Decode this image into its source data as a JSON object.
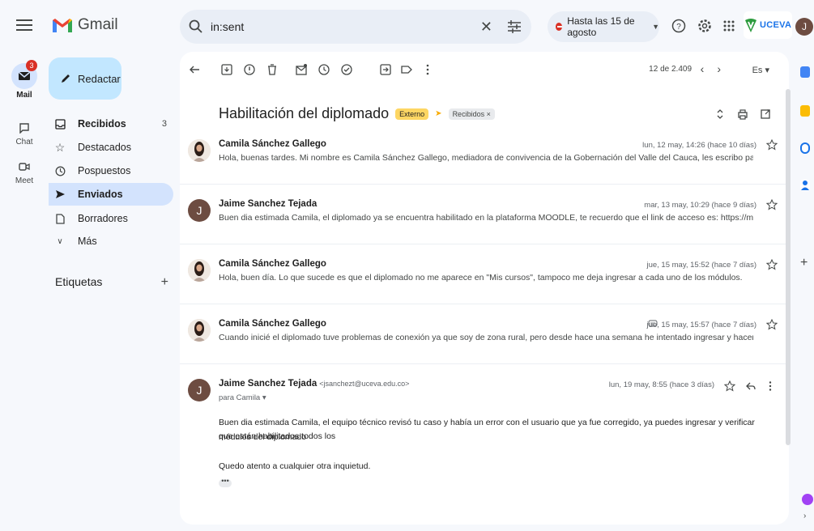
{
  "app": {
    "name": "Gmail"
  },
  "search": {
    "query": "in:sent"
  },
  "status": {
    "label": "Hasta las 15 de agosto"
  },
  "account": {
    "org": "UCEVA",
    "avatar_letter": "J"
  },
  "rail": {
    "mail": {
      "label": "Mail",
      "badge": "3"
    },
    "chat": {
      "label": "Chat"
    },
    "meet": {
      "label": "Meet"
    }
  },
  "compose": {
    "label": "Redactar"
  },
  "nav": {
    "items": [
      {
        "label": "Recibidos",
        "count": "3",
        "icon": "inbox-icon"
      },
      {
        "label": "Destacados",
        "count": "",
        "icon": "star-icon"
      },
      {
        "label": "Pospuestos",
        "count": "",
        "icon": "clock-icon"
      },
      {
        "label": "Enviados",
        "count": "",
        "icon": "send-icon"
      },
      {
        "label": "Borradores",
        "count": "",
        "icon": "draft-icon"
      },
      {
        "label": "Más",
        "count": "",
        "icon": "chevron-down-icon"
      }
    ],
    "labels_title": "Etiquetas",
    "labels_add": "+"
  },
  "toolbar": {
    "pager": "12 de 2.409",
    "lang": "Es"
  },
  "thread": {
    "subject": "Habilitación del diplomado",
    "badge_external": "Externo",
    "badge_inbox": "Recibidos ×",
    "messages": [
      {
        "from": "Camila Sánchez Gallego",
        "date": "lun, 12 may, 14:26 (hace 10 días)",
        "snippet": "Hola, buenas tardes. Mi nombre es Camila Sánchez Gallego, mediadora de convivencia de la Gobernación del Valle del Cauca, les escribo para solicitar por favor l"
      },
      {
        "from": "Jaime Sanchez Tejada",
        "date": "mar, 13 may, 10:29 (hace 9 días)",
        "snippet": "Buen dia estimada Camila, el diplomado ya se encuentra habilitado en la plataforma MOODLE, te recuerdo que el link de acceso es: https://moodleproyeccionsocial."
      },
      {
        "from": "Camila Sánchez Gallego",
        "date": "jue, 15 may, 15:52 (hace 7 días)",
        "snippet": "Hola, buen día. Lo que sucede es que el diplomado no me aparece en \"Mis cursos\", tampoco me deja ingresar a cada uno de los módulos."
      },
      {
        "from": "Camila Sánchez Gallego",
        "date": "jue, 15 may, 15:57 (hace 7 días)",
        "snippet": "Cuando inicié el diplomado tuve problemas de conexión ya que soy de zona rural, pero desde hace una semana he intentado ingresar y hacer los dos primeros módulo"
      }
    ],
    "open_message": {
      "from": "Jaime Sanchez Tejada",
      "email": "<jsanchezt@uceva.edu.co>",
      "to": "para Camila",
      "date": "lun, 19 may, 8:55 (hace 3 días)",
      "body_1": "Buen dia estimada Camila, el equipo técnico revisó tu caso y había un error con el usuario que ya fue corregido, ya puedes ingresar y verificar que están habilitados todos los",
      "body_2": "módulos del diplomado",
      "body_3": "Quedo atento a cualquier otra inquietud.",
      "more": "•••"
    }
  }
}
